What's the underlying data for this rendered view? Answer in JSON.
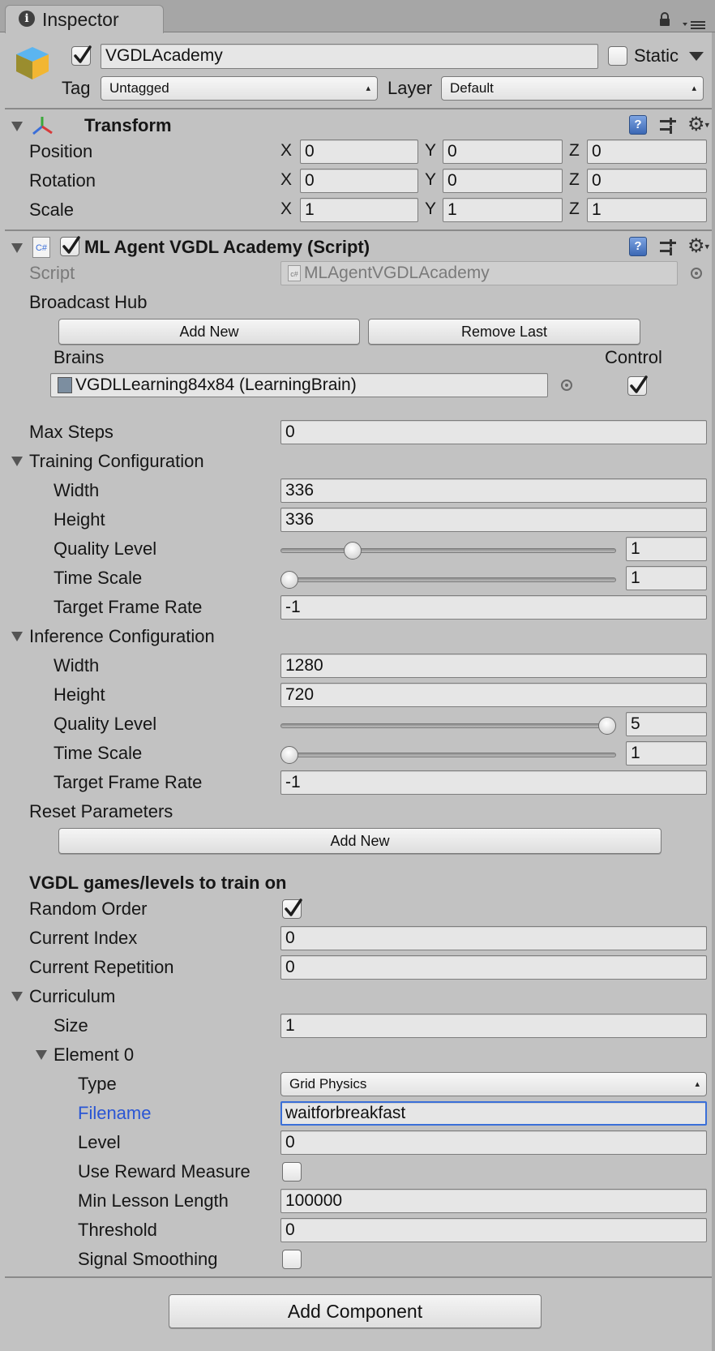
{
  "tab": {
    "title": "Inspector"
  },
  "gameobject": {
    "name": "VGDLAcademy",
    "enabled": true,
    "static_label": "Static",
    "static_checked": false,
    "tag_label": "Tag",
    "tag_value": "Untagged",
    "layer_label": "Layer",
    "layer_value": "Default"
  },
  "transform": {
    "title": "Transform",
    "rows": [
      {
        "label": "Position",
        "x": "0",
        "y": "0",
        "z": "0"
      },
      {
        "label": "Rotation",
        "x": "0",
        "y": "0",
        "z": "0"
      },
      {
        "label": "Scale",
        "x": "1",
        "y": "1",
        "z": "1"
      }
    ],
    "axes": {
      "x": "X",
      "y": "Y",
      "z": "Z"
    }
  },
  "script_component": {
    "title": "ML Agent VGDL Academy (Script)",
    "enabled": true,
    "script_label": "Script",
    "script_value": "MLAgentVGDLAcademy",
    "broadcast_hub_label": "Broadcast Hub",
    "add_new_label": "Add New",
    "remove_last_label": "Remove Last",
    "brains_label": "Brains",
    "control_label": "Control",
    "brain_value": "VGDLLearning84x84 (LearningBrain)",
    "control_checked": true,
    "max_steps_label": "Max Steps",
    "max_steps_value": "0",
    "training": {
      "header": "Training Configuration",
      "width_label": "Width",
      "width": "336",
      "height_label": "Height",
      "height": "336",
      "quality_label": "Quality Level",
      "quality": "1",
      "quality_fraction": 0.2,
      "timescale_label": "Time Scale",
      "timescale": "1",
      "timescale_fraction": 0.0,
      "framerate_label": "Target Frame Rate",
      "framerate": "-1"
    },
    "inference": {
      "header": "Inference Configuration",
      "width_label": "Width",
      "width": "1280",
      "height_label": "Height",
      "height": "720",
      "quality_label": "Quality Level",
      "quality": "5",
      "quality_fraction": 1.0,
      "timescale_label": "Time Scale",
      "timescale": "1",
      "timescale_fraction": 0.0,
      "framerate_label": "Target Frame Rate",
      "framerate": "-1"
    },
    "reset_params_label": "Reset Parameters",
    "reset_add_new_label": "Add New",
    "vgdl_header": "VGDL games/levels to train on",
    "random_order_label": "Random Order",
    "random_order_checked": true,
    "current_index_label": "Current Index",
    "current_index": "0",
    "current_repetition_label": "Current Repetition",
    "current_repetition": "0",
    "curriculum": {
      "header": "Curriculum",
      "size_label": "Size",
      "size": "1",
      "element_label": "Element 0",
      "type_label": "Type",
      "type_value": "Grid Physics",
      "filename_label": "Filename",
      "filename_value": "waitforbreakfast",
      "level_label": "Level",
      "level_value": "0",
      "use_reward_label": "Use Reward Measure",
      "use_reward_checked": false,
      "min_lesson_label": "Min Lesson Length",
      "min_lesson_value": "100000",
      "threshold_label": "Threshold",
      "threshold_value": "0",
      "signal_smoothing_label": "Signal Smoothing",
      "signal_smoothing_checked": false
    }
  },
  "add_component_label": "Add Component",
  "colors": {
    "panel": "#c2c2c2",
    "focus": "#3a6fd8",
    "link_label": "#2a56d4"
  }
}
